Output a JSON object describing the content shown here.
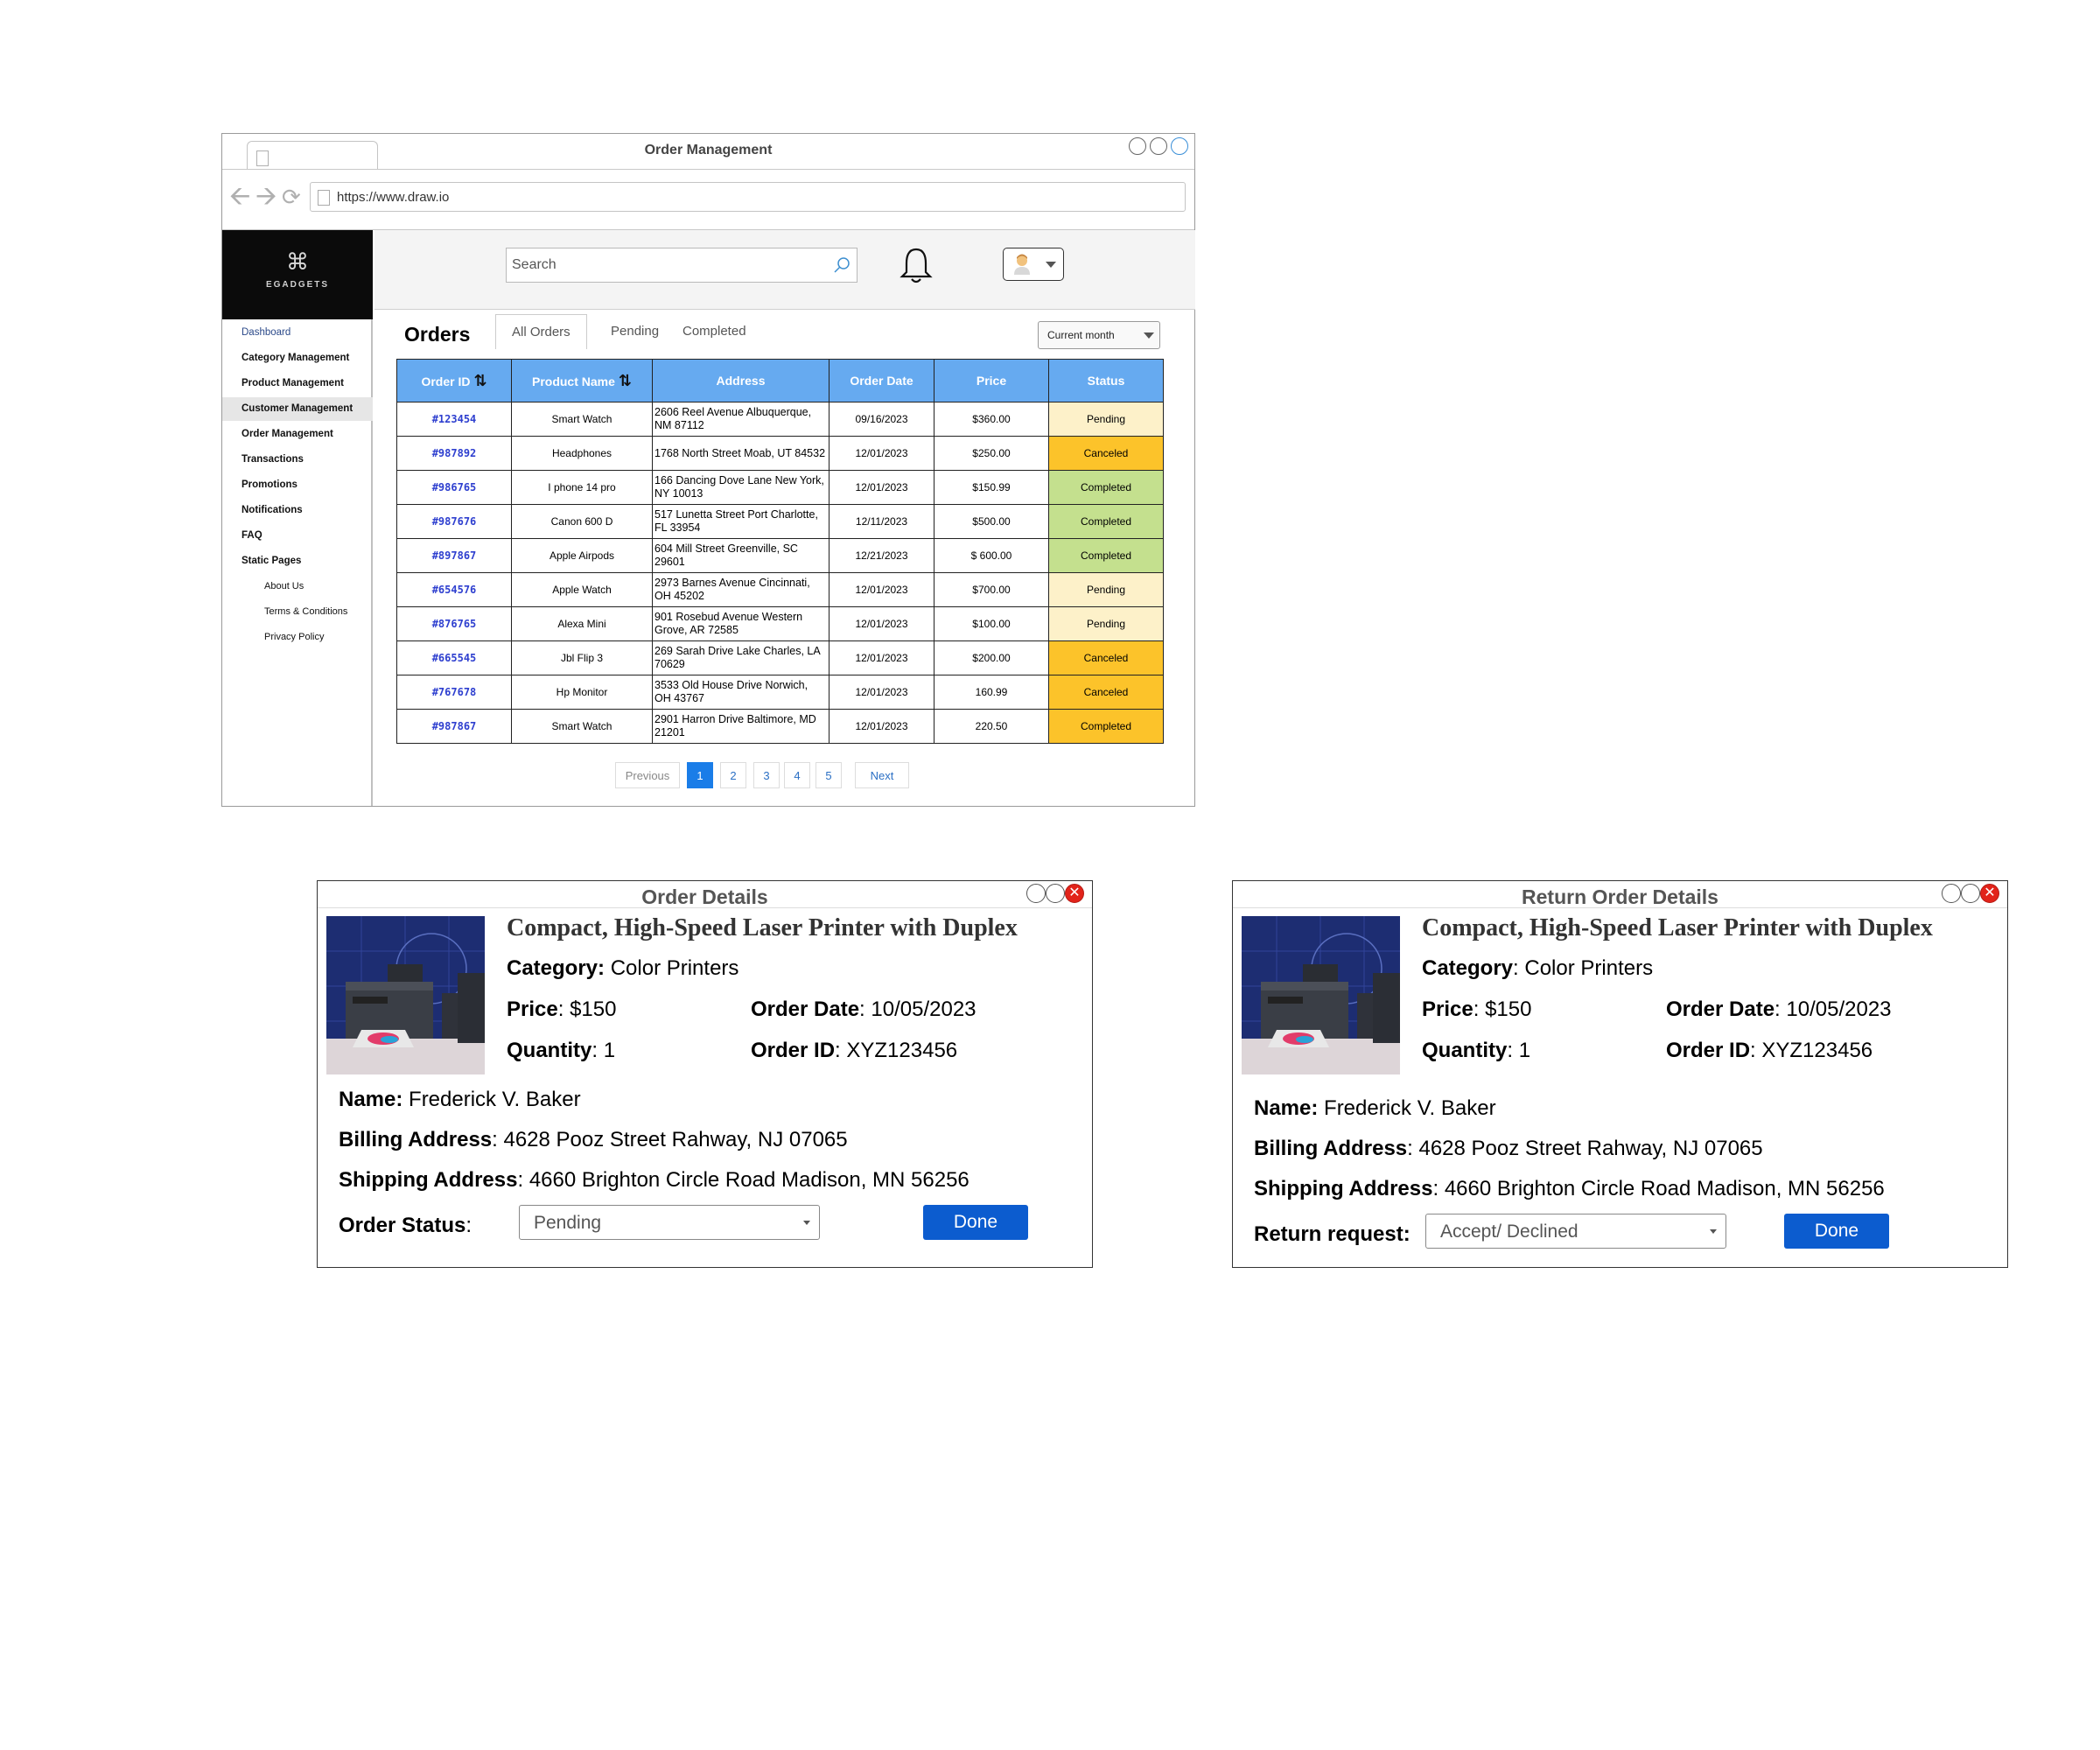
{
  "window": {
    "title": "Order Management",
    "url": "https://www.draw.io"
  },
  "brand": {
    "name": "EGADGETS"
  },
  "sidebar": {
    "items": [
      {
        "label": "Dashboard"
      },
      {
        "label": "Category Management"
      },
      {
        "label": "Product Management"
      },
      {
        "label": "Customer Management"
      },
      {
        "label": "Order Management"
      },
      {
        "label": "Transactions"
      },
      {
        "label": "Promotions"
      },
      {
        "label": "Notifications"
      },
      {
        "label": "FAQ"
      },
      {
        "label": "Static Pages"
      },
      {
        "label": "About Us"
      },
      {
        "label": "Terms & Conditions"
      },
      {
        "label": "Privacy Policy"
      }
    ]
  },
  "search": {
    "placeholder": "Search"
  },
  "orders": {
    "title": "Orders",
    "tabs": [
      "All Orders",
      "Pending",
      "Completed"
    ],
    "filter": "Current month",
    "columns": [
      "Order ID",
      "Product Name",
      "Address",
      "Order Date",
      "Price",
      "Status"
    ],
    "rows": [
      {
        "id": "#123454",
        "product": "Smart Watch",
        "address": "2606 Reel Avenue Albuquerque, NM 87112",
        "date": "09/16/2023",
        "price": "$360.00",
        "status": "Pending"
      },
      {
        "id": "#987892",
        "product": "Headphones",
        "address": "1768 North Street Moab, UT 84532",
        "date": "12/01/2023",
        "price": "$250.00",
        "status": "Canceled"
      },
      {
        "id": "#986765",
        "product": "I phone 14 pro",
        "address": "166 Dancing Dove Lane New York, NY 10013",
        "date": "12/01/2023",
        "price": "$150.99",
        "status": "Completed"
      },
      {
        "id": "#987676",
        "product": "Canon 600 D",
        "address": "517 Lunetta Street Port Charlotte, FL 33954",
        "date": "12/11/2023",
        "price": "$500.00",
        "status": "Completed"
      },
      {
        "id": "#897867",
        "product": "Apple Airpods",
        "address": "604 Mill Street Greenville, SC 29601",
        "date": "12/21/2023",
        "price": "$ 600.00",
        "status": "Completed"
      },
      {
        "id": "#654576",
        "product": "Apple Watch",
        "address": "2973 Barnes Avenue Cincinnati, OH 45202",
        "date": "12/01/2023",
        "price": "$700.00",
        "status": "Pending"
      },
      {
        "id": "#876765",
        "product": "Alexa Mini",
        "address": "901 Rosebud Avenue Western Grove, AR 72585",
        "date": "12/01/2023",
        "price": "$100.00",
        "status": "Pending"
      },
      {
        "id": "#665545",
        "product": "Jbl Flip 3",
        "address": "269 Sarah Drive Lake Charles, LA 70629",
        "date": "12/01/2023",
        "price": "$200.00",
        "status": "Canceled"
      },
      {
        "id": "#767678",
        "product": "Hp Monitor",
        "address": "3533 Old House Drive Norwich, OH 43767",
        "date": "12/01/2023",
        "price": "160.99",
        "status": "Canceled"
      },
      {
        "id": "#987867",
        "product": "Smart Watch",
        "address": "2901 Harron Drive Baltimore, MD 21201",
        "date": "12/01/2023",
        "price": "220.50",
        "status": "Completed"
      }
    ],
    "status_colors": {
      "Pending": "#fdf1c9",
      "Canceled": "#fcc32a",
      "Completed": "#c4e08e"
    },
    "last_row_color": "#fcc32a"
  },
  "pagination": {
    "previous": "Previous",
    "pages": [
      "1",
      "2",
      "3",
      "4",
      "5"
    ],
    "next": "Next",
    "current": "1"
  },
  "order_details": {
    "title": "Order Details",
    "product_title": "Compact, High-Speed Laser Printer with Duplex",
    "category_label": "Category:",
    "category": "Color Printers",
    "price_label": "Price",
    "price": "$150",
    "order_date_label": "Order Date",
    "order_date": "10/05/2023",
    "quantity_label": "Quantity",
    "quantity": "1",
    "order_id_label": "Order ID",
    "order_id": "XYZ123456",
    "name_label": "Name:",
    "name": "Frederick V. Baker",
    "billing_label": "Billing Address",
    "billing": "4628 Pooz Street Rahway, NJ 07065",
    "shipping_label": "Shipping Address",
    "shipping": "4660 Brighton Circle Road Madison, MN 56256",
    "status_label": "Order Status",
    "status_value": "Pending",
    "done": "Done"
  },
  "return_details": {
    "title": "Return Order Details",
    "product_title": "Compact, High-Speed Laser Printer with Duplex",
    "category_label": "Category",
    "category": "Color Printers",
    "price_label": "Price",
    "price": "$150",
    "order_date_label": "Order Date",
    "order_date": "10/05/2023",
    "quantity_label": "Quantity",
    "quantity": "1",
    "order_id_label": "Order ID",
    "order_id": "XYZ123456",
    "name_label": "Name:",
    "name": "Frederick V. Baker",
    "billing_label": "Billing Address",
    "billing": "4628 Pooz Street Rahway, NJ 07065",
    "shipping_label": "Shipping Address",
    "shipping": "4660 Brighton Circle Road Madison, MN 56256",
    "return_label": "Return request:",
    "return_value": "Accept/ Declined",
    "done": "Done"
  }
}
